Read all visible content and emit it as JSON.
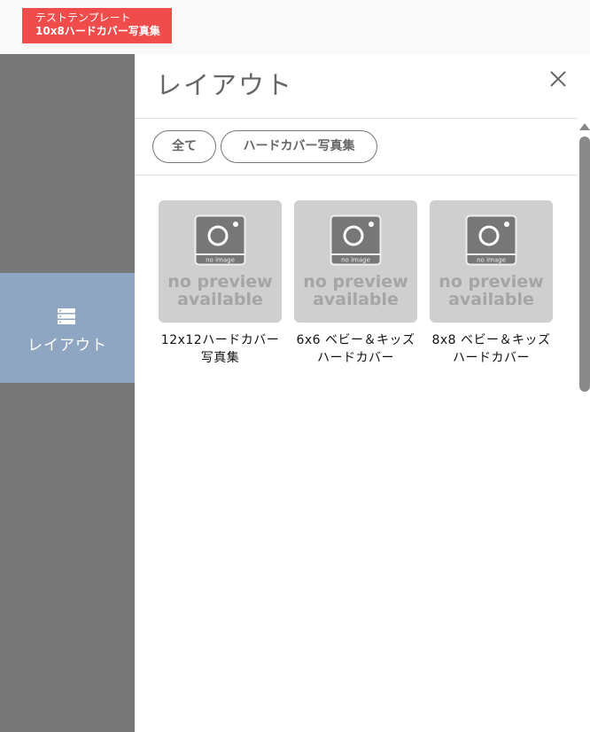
{
  "project": {
    "line1": "テストテンプレート",
    "line2": "10x8ハードカバー写真集",
    "color": "#f04c4c"
  },
  "sidebar": {
    "items": [
      {
        "label": "レイアウト",
        "icon": "layout-list-icon",
        "active": true
      }
    ]
  },
  "panel": {
    "title": "レイアウト",
    "close_icon": "close-icon",
    "filters": [
      {
        "label": "全て"
      },
      {
        "label": "ハードカバー写真集"
      }
    ],
    "templates": [
      {
        "title": "12x12ハードカバー写真集",
        "preview": {
          "caption": "no image",
          "line1": "no preview",
          "line2": "available"
        }
      },
      {
        "title": "6x6 ベビー＆キッズ ハードカバー",
        "preview": {
          "caption": "no image",
          "line1": "no preview",
          "line2": "available"
        }
      },
      {
        "title": "8x8 ベビー＆キッズ ハードカバー",
        "preview": {
          "caption": "no image",
          "line1": "no preview",
          "line2": "available"
        }
      }
    ]
  }
}
